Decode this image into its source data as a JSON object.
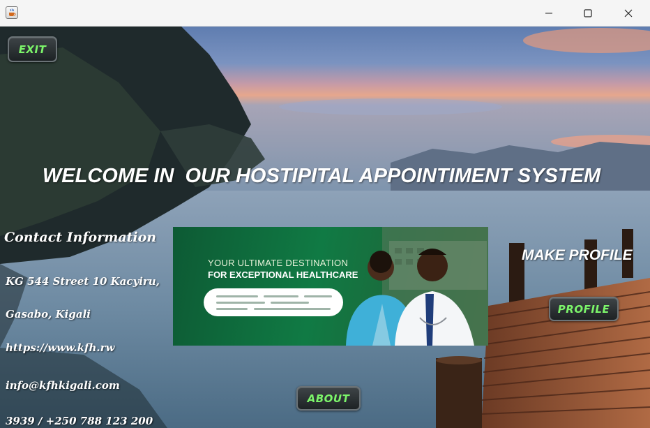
{
  "window": {
    "title": "",
    "app_icon": "java-cup-icon",
    "controls": [
      "minimize-icon",
      "maximize-icon",
      "close-icon"
    ]
  },
  "buttons": {
    "exit": "EXIT",
    "profile": "PROFILE",
    "about": "ABOUT"
  },
  "welcome_heading": "WELCOME IN  OUR HOSTIPITAL APPOINTIMENT SYSTEM",
  "contact": {
    "title": "Contact Information",
    "lines": [
      "KG 544 Street 10 Kacyiru,",
      "Gasabo, Kigali",
      "https://www.kfh.rw",
      "info@kfhkigali.com",
      "3939 / +250 788 123 200"
    ]
  },
  "make_profile_label": "MAKE PROFILE",
  "banner": {
    "line1": "YOUR ULTIMATE DESTINATION",
    "line2": "FOR EXCEPTIONAL HEALTHCARE"
  },
  "colors": {
    "button_text": "#7cf56a",
    "button_bg": "#2a3033",
    "banner_green": "#107a44",
    "text": "#ffffff"
  }
}
